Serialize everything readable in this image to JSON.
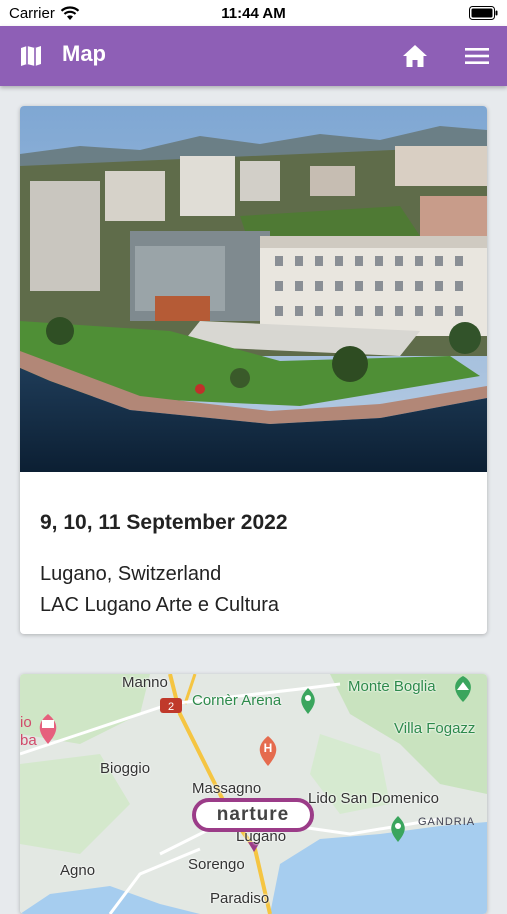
{
  "status_bar": {
    "carrier": "Carrier",
    "time": "11:44 AM",
    "icons": [
      "wifi-icon",
      "battery-icon"
    ]
  },
  "app_bar": {
    "title": "Map",
    "background": "#8e5fb6",
    "icons": [
      "map-icon",
      "home-icon",
      "menu-icon"
    ]
  },
  "event": {
    "photo": "aerial view of lakeside LAC Lugano Arte e Cultura building",
    "date": "9, 10, 11 September 2022",
    "city": "Lugano, Switzerland",
    "venue": "LAC Lugano Arte e Cultura"
  },
  "map": {
    "labels": {
      "manno": "Manno",
      "corner_arena": "Cornèr Arena",
      "monte_boglia": "Monte Boglia",
      "villa_fogazz": "Villa Fogazz",
      "bioggio": "Bioggio",
      "massagno": "Massagno",
      "lido": "Lido San Domenico",
      "gandria": "GANDRIA",
      "lugano": "Lugano",
      "sorengo": "Sorengo",
      "agno": "Agno",
      "paradiso": "Paradiso",
      "edge_top": "io",
      "edge_bottom": "ba",
      "road_number": "2"
    },
    "marker": "narture"
  }
}
